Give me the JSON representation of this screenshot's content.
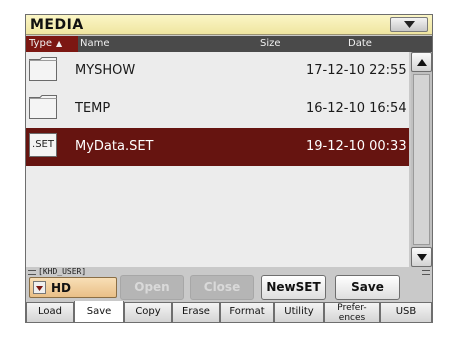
{
  "window": {
    "title": "MEDIA",
    "menu_icon": "chevron-down-icon"
  },
  "columns": {
    "type": "Type",
    "name": "Name",
    "size": "Size",
    "date": "Date",
    "sort_icon": "sort-up-icon"
  },
  "files": [
    {
      "type": "folder",
      "icon": "folder-icon",
      "name": "MYSHOW",
      "size": "",
      "date": "17-12-10 22:55",
      "selected": false
    },
    {
      "type": "folder",
      "icon": "folder-icon",
      "name": "TEMP",
      "size": "",
      "date": "16-12-10 16:54",
      "selected": false
    },
    {
      "type": "set",
      "icon_label": ".SET",
      "name": "MyData.SET",
      "size": "",
      "date": "19-12-10 00:33",
      "selected": true
    }
  ],
  "path": "[KHD_USER]",
  "drive": {
    "label": "HD"
  },
  "buttons": {
    "open": "Open",
    "close": "Close",
    "newset": "NewSET",
    "save": "Save"
  },
  "tabs": [
    {
      "label": "Load",
      "active": false
    },
    {
      "label": "Save",
      "active": true
    },
    {
      "label": "Copy",
      "active": false
    },
    {
      "label": "Erase",
      "active": false
    },
    {
      "label": "Format",
      "active": false
    },
    {
      "label": "Utility",
      "active": false
    },
    {
      "label_line1": "Prefer-",
      "label_line2": "ences",
      "active": false
    },
    {
      "label": "USB",
      "active": false
    }
  ],
  "colors": {
    "title_bar": "#f3ebb0",
    "selected_row": "#661410",
    "sort_column": "#7c1712",
    "drive_button": "#efcb95"
  }
}
